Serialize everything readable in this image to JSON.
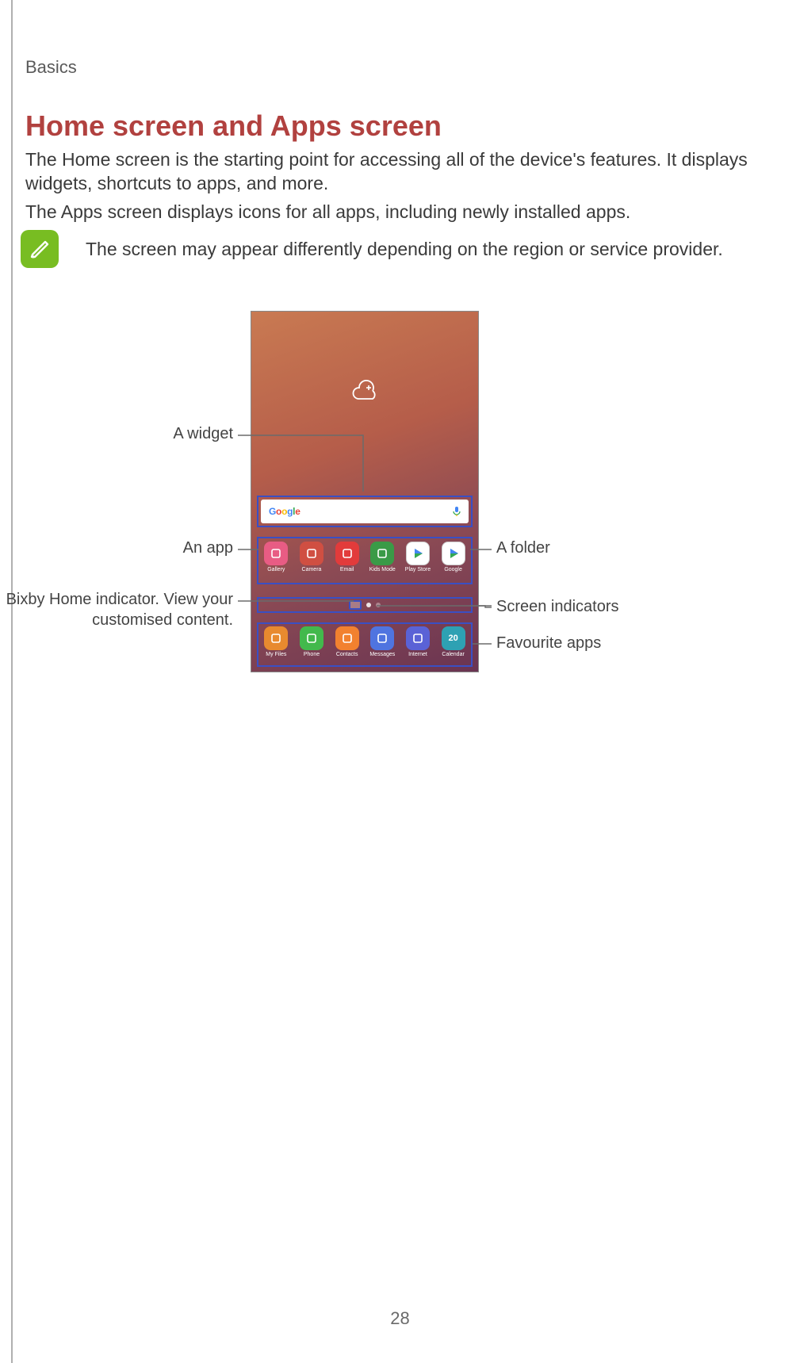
{
  "header_section": "Basics",
  "heading": "Home screen and Apps screen",
  "paragraph1": "The Home screen is the starting point for accessing all of the device's features. It displays widgets, shortcuts to apps, and more.",
  "paragraph2": "The Apps screen displays icons for all apps, including newly installed apps.",
  "note_text": "The screen may appear differently depending on the region or service provider.",
  "callouts": {
    "widget": "A widget",
    "app": "An app",
    "bixby": "Bixby Home indicator. View your customised content.",
    "folder": "A folder",
    "screen_indicators": "Screen indicators",
    "favourite_apps": "Favourite apps"
  },
  "search": {
    "logo": "Google"
  },
  "apps_row": [
    {
      "label": "Gallery",
      "color": "#e85c84"
    },
    {
      "label": "Camera",
      "color": "#d04f42"
    },
    {
      "label": "Email",
      "color": "#e23b3b"
    },
    {
      "label": "Kids Mode",
      "color": "#3a9a47"
    },
    {
      "label": "Play Store",
      "color": "#ffffff"
    },
    {
      "label": "Google",
      "color": "#ffffff"
    }
  ],
  "dock_row": [
    {
      "label": "My Files",
      "color": "#e88a2f"
    },
    {
      "label": "Phone",
      "color": "#42b94c"
    },
    {
      "label": "Contacts",
      "color": "#f2812f"
    },
    {
      "label": "Messages",
      "color": "#4f74e0"
    },
    {
      "label": "Internet",
      "color": "#5a62d6"
    },
    {
      "label": "Calendar",
      "color": "#2ea1b3",
      "day": "20"
    }
  ],
  "page_number": "28"
}
